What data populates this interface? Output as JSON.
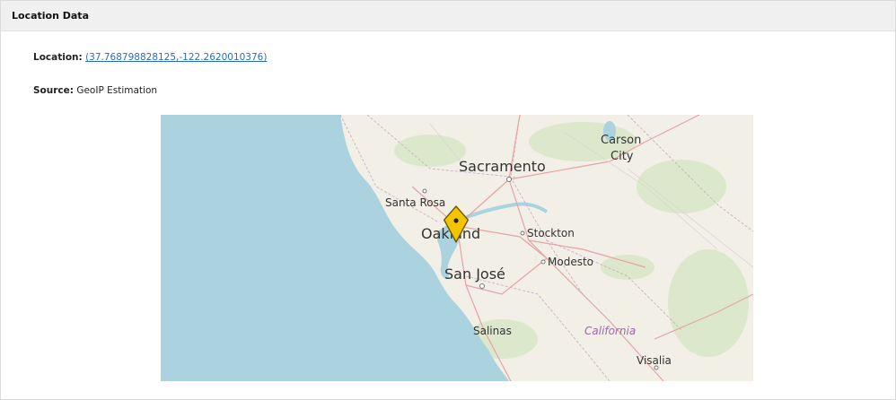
{
  "panel": {
    "title": "Location Data"
  },
  "location": {
    "label": "Location:",
    "value": "(37.768798828125,-122.2620010376)"
  },
  "source": {
    "label": "Source:",
    "value": "GeoIP Estimation"
  },
  "map": {
    "cities": {
      "carson": "Carson",
      "city": "City",
      "sacramento": "Sacramento",
      "santa_rosa": "Santa Rosa",
      "oakland": "Oakland",
      "stockton": "Stockton",
      "modesto": "Modesto",
      "san_jose": "San José",
      "salinas": "Salinas",
      "california": "California",
      "visalia": "Visalia"
    },
    "colors": {
      "water": "#aad3df",
      "land": "#f1efe6",
      "marker": "#f5c400",
      "marker_outline": "#6b5a00"
    },
    "marker_icon": "map-pin-icon"
  }
}
